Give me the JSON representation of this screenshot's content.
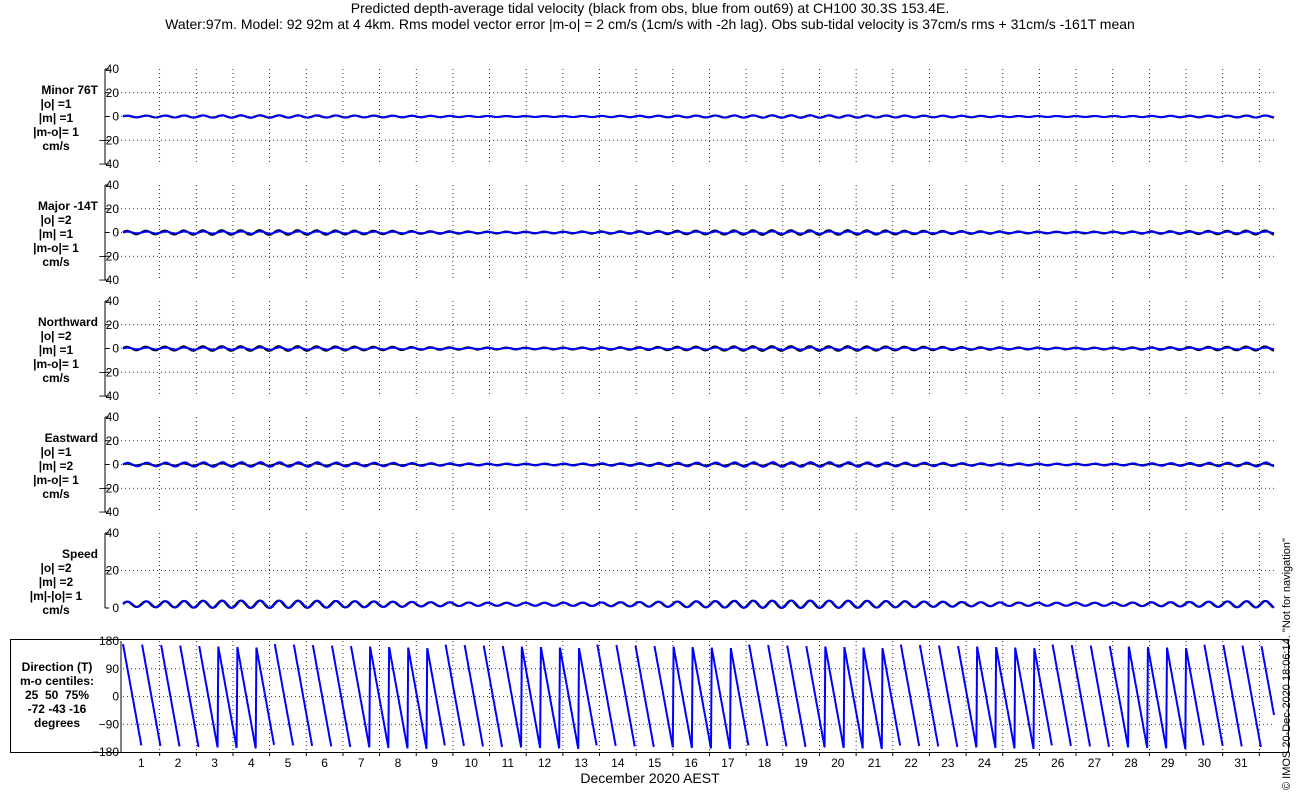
{
  "title_line1": "Predicted depth-average tidal velocity (black from obs, blue from out69) at CH100 30.3S 153.4E.",
  "title_line2": "Water:97m. Model: 92 92m at 4 4km. Rms model vector error |m-o| = 2 cm/s (1cm/s with -2h lag). Obs sub-tidal velocity is 37cm/s rms + 31cm/s -161T mean",
  "credit": "© IMOS 20-Dec-2020 18:06:14. \"Not for navigation\"",
  "colors": {
    "obs": "#000000",
    "model": "#0000ff",
    "grid": "#000000"
  },
  "chart_data": {
    "type": "line",
    "xlabel": "December 2020 AEST",
    "x_ticks": [
      "1",
      "2",
      "3",
      "4",
      "5",
      "6",
      "7",
      "8",
      "9",
      "10",
      "11",
      "12",
      "13",
      "14",
      "15",
      "16",
      "17",
      "18",
      "19",
      "20",
      "21",
      "22",
      "23",
      "24",
      "25",
      "26",
      "27",
      "28",
      "29",
      "30",
      "31"
    ],
    "series_names": {
      "obs": "obs (black)",
      "model": "out69 (blue)"
    },
    "panels": [
      {
        "id": "minor",
        "label_lines": [
          "Minor 76T",
          "|o| =1",
          "|m| =1",
          "|m-o|= 1",
          "cm/s"
        ],
        "y_ticks": [
          "40",
          "20",
          "0",
          "−20",
          "−40"
        ],
        "ylim": [
          -40,
          40
        ],
        "obs_amp": 1,
        "model_amp": 1
      },
      {
        "id": "major",
        "label_lines": [
          "Major -14T",
          "|o| =2",
          "|m| =1",
          "|m-o|= 1",
          "cm/s"
        ],
        "y_ticks": [
          "40",
          "20",
          "0",
          "−20",
          "−40"
        ],
        "ylim": [
          -40,
          40
        ],
        "obs_amp": 2,
        "model_amp": 1
      },
      {
        "id": "north",
        "label_lines": [
          "Northward",
          "|o| =2",
          "|m| =1",
          "|m-o|= 1",
          "cm/s"
        ],
        "y_ticks": [
          "40",
          "20",
          "0",
          "−20",
          "−40"
        ],
        "ylim": [
          -40,
          40
        ],
        "obs_amp": 2,
        "model_amp": 1
      },
      {
        "id": "east",
        "label_lines": [
          "Eastward",
          "|o| =1",
          "|m| =2",
          "|m-o|= 1",
          "cm/s"
        ],
        "y_ticks": [
          "40",
          "20",
          "0",
          "−20",
          "−40"
        ],
        "ylim": [
          -40,
          40
        ],
        "obs_amp": 1,
        "model_amp": 2
      },
      {
        "id": "speed",
        "label_lines": [
          "Speed",
          "|o| =2",
          "|m| =2",
          "|m|-|o|= 1",
          "cm/s"
        ],
        "y_ticks": [
          "40",
          "20",
          "0"
        ],
        "ylim": [
          0,
          40
        ],
        "obs_amp": 2,
        "model_amp": 2
      },
      {
        "id": "direction",
        "label_lines": [
          "Direction (T)",
          "m-o centiles:",
          "25  50  75%",
          "-72 -43 -16",
          "degrees"
        ],
        "y_ticks": [
          "180",
          "90",
          "0",
          "−90",
          "−180"
        ],
        "ylim": [
          -180,
          180
        ]
      }
    ],
    "x_range_days": [
      0,
      31.4
    ]
  }
}
